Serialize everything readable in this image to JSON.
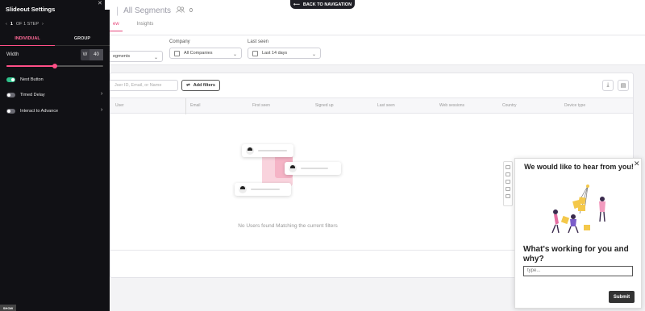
{
  "back_nav": {
    "label": "BACK TO NAVIGATION"
  },
  "header": {
    "title": "All Segments",
    "count": "0",
    "tabs": [
      {
        "label": "ew"
      },
      {
        "label": "Insights"
      }
    ]
  },
  "filters": {
    "segment": {
      "value": "egments"
    },
    "company": {
      "label": "Company",
      "value": "All Companies"
    },
    "last_seen": {
      "label": "Last seen",
      "value": "Last 14 days"
    }
  },
  "table": {
    "search_placeholder": "Jser ID, Email, or Name",
    "add_filters_label": "Add filters",
    "columns": [
      "User",
      "Email",
      "First seen",
      "Signed up",
      "Last seen",
      "Web sessions",
      "Country",
      "Device type"
    ],
    "empty_message": "No Users found Matching the current filters"
  },
  "panel": {
    "title": "Slideout Settings",
    "step_index": "1",
    "step_label": "OF 1 STEP",
    "tabs": [
      {
        "label": "INDIVIDUAL"
      },
      {
        "label": "GROUP"
      }
    ],
    "width_label": "Width",
    "width_prefix": "W",
    "width_value": "40",
    "width_slider_fraction": 0.5,
    "toggles": [
      {
        "label": "Next Button",
        "on": true
      },
      {
        "label": "Timed Delay",
        "on": false
      },
      {
        "label": "Interact to Advance",
        "on": false
      }
    ],
    "bottom_label": "SHOW"
  },
  "survey": {
    "heading": "We would like to hear from you!",
    "question": "What's working for you and why?",
    "input_placeholder": "type...",
    "submit_label": "Submit"
  },
  "colors": {
    "accent": "#ff4f87",
    "toggle_on": "#2fc28b",
    "panel_bg": "#111115"
  }
}
